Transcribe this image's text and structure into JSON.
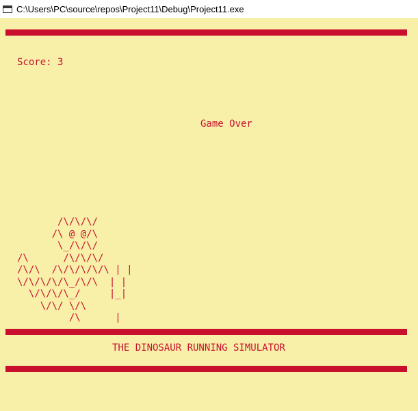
{
  "window": {
    "title": "C:\\Users\\PC\\source\\repos\\Project11\\Debug\\Project11.exe",
    "icon": "console-window-icon"
  },
  "console": {
    "background": "#f8f0a8",
    "foreground": "#c8102e",
    "score_label": "Score:",
    "score_value": "3",
    "game_over": "Game Over",
    "footer_title": "THE DINOSAUR RUNNING SIMULATOR",
    "ascii_art": "       /\\/\\/\\/\n      /\\ @ @/\\\n       \\_/\\/\\/\n/\\      /\\/\\/\\/\n/\\/\\  /\\/\\/\\/\\/\\ | |\n\\/\\/\\/\\/\\_/\\/\\  | |\n  \\/\\/\\/\\_/     |_|\n    \\/\\/ \\/\\\n         /\\      |"
  }
}
